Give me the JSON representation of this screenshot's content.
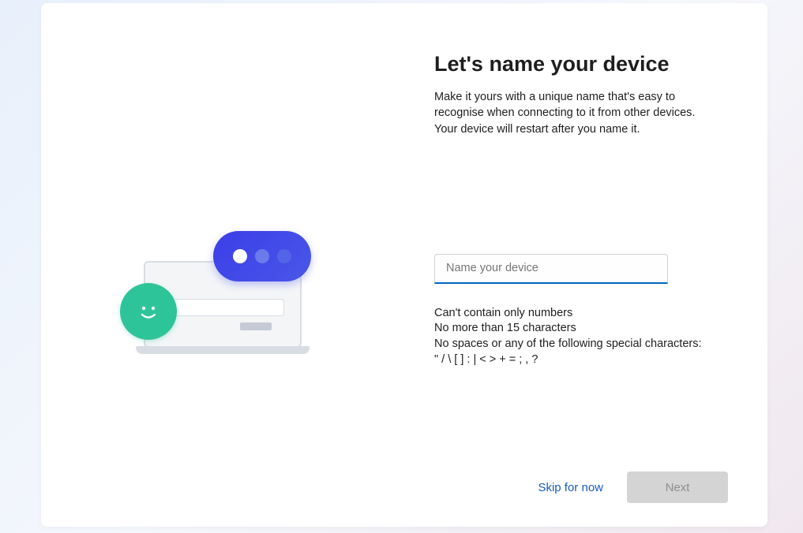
{
  "header": {
    "title": "Let's name your device",
    "description": "Make it yours with a unique name that's easy to recognise when connecting to it from other devices. Your device will restart after you name it."
  },
  "input": {
    "placeholder": "Name your device",
    "value": ""
  },
  "rules": {
    "line1": "Can't contain only numbers",
    "line2": "No more than 15 characters",
    "line3": "No spaces or any of the following special characters:",
    "line4": "\" / \\ [ ] : | < > + = ; , ?"
  },
  "footer": {
    "skip_label": "Skip for now",
    "next_label": "Next"
  },
  "colors": {
    "accent": "#0067c0",
    "link": "#185abd",
    "smiley": "#2ec49a",
    "bubble": "#3b3ee8"
  }
}
